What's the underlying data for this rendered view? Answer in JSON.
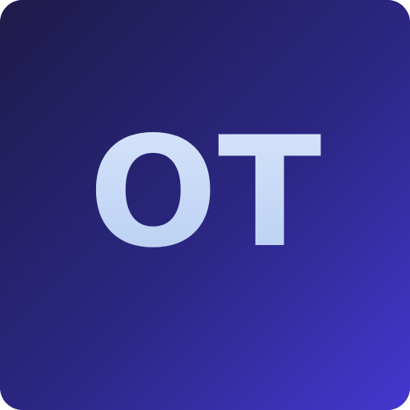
{
  "icon": {
    "monogram": "OT",
    "colors": {
      "bg_start": "#1f1b4a",
      "bg_mid": "#2a267a",
      "bg_end": "#4437d0",
      "text_top": "#d8e6fb",
      "text_bottom": "#b7cdf2"
    }
  }
}
